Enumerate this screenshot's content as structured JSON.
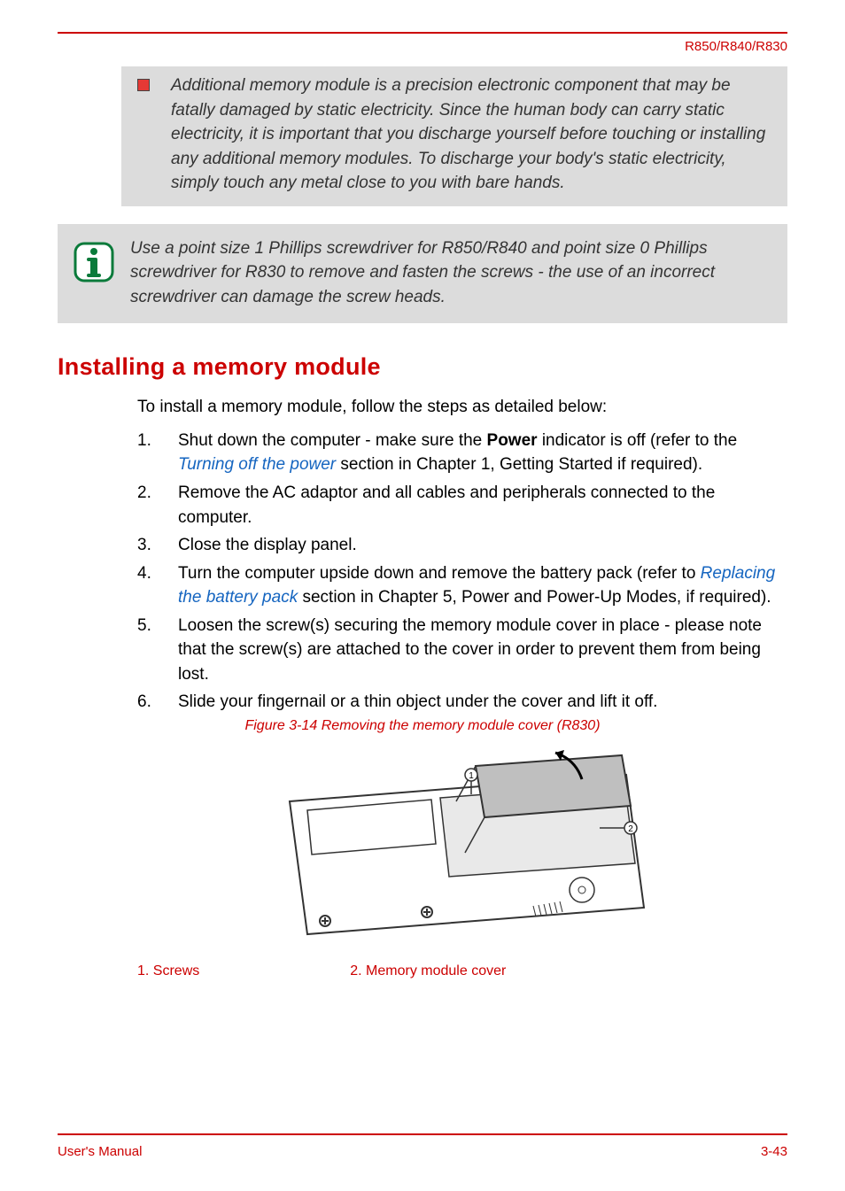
{
  "header": {
    "product": "R850/R840/R830"
  },
  "callouts": {
    "warning_bullet": "Additional memory module is a precision electronic component that may be fatally damaged by static electricity. Since the human body can carry static electricity, it is important that you discharge yourself before touching or installing any additional memory modules. To discharge your body's static electricity, simply touch any metal close to you with bare hands.",
    "info_note": "Use a point size 1 Phillips screwdriver for R850/R840 and point size 0 Phillips screwdriver for R830 to remove and fasten the screws - the use of an incorrect screwdriver can damage the screw heads."
  },
  "section": {
    "title": "Installing a memory module",
    "intro": "To install a memory module, follow the steps as detailed below:",
    "steps": [
      {
        "num": "1.",
        "pre": "Shut down the computer - make sure the ",
        "bold": "Power",
        "mid": " indicator is off (refer to the ",
        "link": "Turning off the power",
        "post": " section in Chapter 1, Getting Started if required)."
      },
      {
        "num": "2.",
        "text": "Remove the AC adaptor and all cables and peripherals connected to the computer."
      },
      {
        "num": "3.",
        "text": "Close the display panel."
      },
      {
        "num": "4.",
        "pre": "Turn the computer upside down and remove the battery pack (refer to ",
        "link": "Replacing the battery pack",
        "post": " section in Chapter 5, Power and Power-Up Modes, if required)."
      },
      {
        "num": "5.",
        "text": "Loosen the screw(s) securing the memory module cover in place - please note that the screw(s) are attached to the cover in order to prevent them from being lost."
      },
      {
        "num": "6.",
        "text": "Slide your fingernail or a thin object under the cover and lift it off."
      }
    ]
  },
  "figure": {
    "caption": "Figure 3-14 Removing the memory module cover (R830)",
    "label1": "1. Screws",
    "label2": "2. Memory module cover"
  },
  "footer": {
    "left": "User's Manual",
    "right": "3-43"
  },
  "icons": {
    "bullet": "warning-bullet-icon",
    "info": "info-icon"
  }
}
